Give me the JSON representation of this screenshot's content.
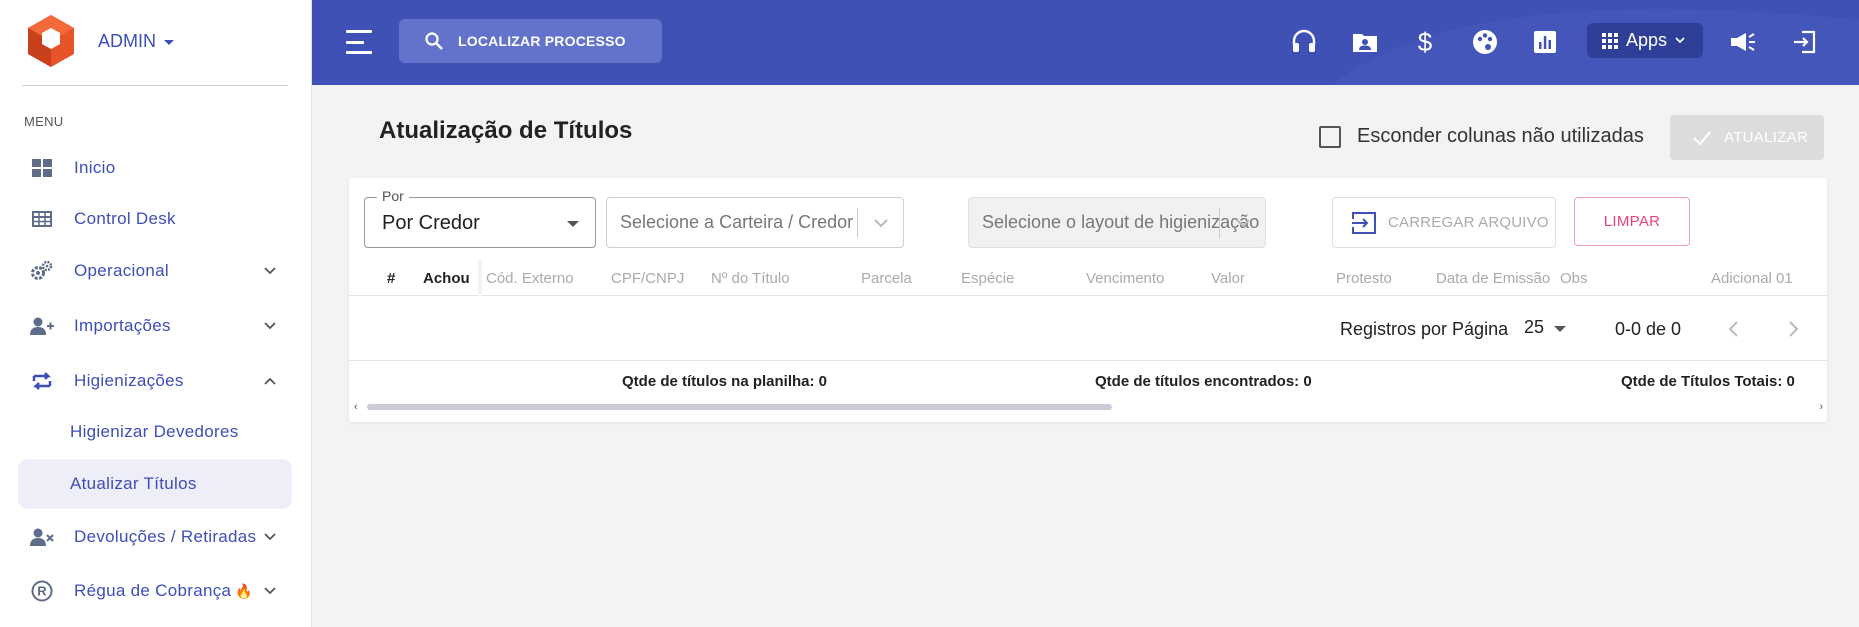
{
  "app": {
    "user_label": "ADMIN",
    "accent_color": "#3f51b5"
  },
  "sidebar": {
    "menu_label": "MENU",
    "items": [
      {
        "label": "Inicio",
        "icon": "dashboard-icon",
        "expandable": false
      },
      {
        "label": "Control Desk",
        "icon": "table-icon",
        "expandable": false
      },
      {
        "label": "Operacional",
        "icon": "gears-icon",
        "expandable": true
      },
      {
        "label": "Importações",
        "icon": "user-plus-icon",
        "expandable": true
      },
      {
        "label": "Higienizações",
        "icon": "swap-icon",
        "expandable": true,
        "expanded": true
      },
      {
        "label": "Higienizar Devedores",
        "sub": true
      },
      {
        "label": "Atualizar Títulos",
        "sub": true,
        "active": true
      },
      {
        "label": "Devoluções / Retiradas",
        "icon": "user-remove-icon",
        "expandable": true
      },
      {
        "label": "Régua de Cobrança",
        "icon": "registered-icon",
        "expandable": true,
        "badge": "fire-icon"
      }
    ]
  },
  "header": {
    "search_label": "LOCALIZAR PROCESSO",
    "apps_label": "Apps",
    "icons": [
      "headset-icon",
      "contact-folder-icon",
      "dollar-icon",
      "palette-icon",
      "bar-chart-icon",
      "megaphone-icon",
      "logout-icon"
    ]
  },
  "page": {
    "title": "Atualização de Títulos",
    "hide_columns_label": "Esconder colunas não utilizadas",
    "update_button": "ATUALIZAR"
  },
  "filters": {
    "por_legend": "Por",
    "por_value": "Por Credor",
    "carteira_placeholder": "Selecione a Carteira / Credor",
    "layout_placeholder": "Selecione o layout de higienização",
    "upload_button": "CARREGAR ARQUIVO",
    "clear_button": "LIMPAR"
  },
  "table": {
    "columns": [
      "#",
      "Achou",
      "Cód. Externo",
      "CPF/CNPJ",
      "Nº do Título",
      "Parcela",
      "Espécie",
      "Vencimento",
      "Valor",
      "Protesto",
      "Data de Emissão",
      "Obs",
      "Adicional 01"
    ]
  },
  "pagination": {
    "rows_per_page_label": "Registros por Página",
    "rows_per_page": "25",
    "range": "0-0 de 0"
  },
  "summary": {
    "sheet_count": "Qtde de títulos na planilha: 0",
    "found_count": "Qtde de títulos encontrados: 0",
    "total_count": "Qtde de Títulos Totais: 0"
  }
}
